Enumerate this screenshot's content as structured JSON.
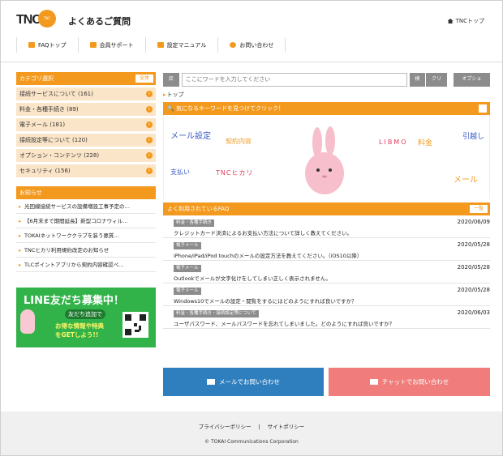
{
  "header": {
    "logo_text": "TNC",
    "logo_badge": "TNC",
    "title": "よくあるご質問",
    "top_link": "TNCトップ"
  },
  "nav": [
    {
      "label": "FAQトップ",
      "icon": "chat-icon"
    },
    {
      "label": "会員サポート",
      "icon": "people-icon"
    },
    {
      "label": "設定マニュアル",
      "icon": "book-icon"
    },
    {
      "label": "お問い合わせ",
      "icon": "phone-icon"
    }
  ],
  "sidebar": {
    "category_title": "カテゴリ選択",
    "all_label": "全体",
    "categories": [
      {
        "label": "接続サービスについて (161)"
      },
      {
        "label": "料金・各種手続き (89)"
      },
      {
        "label": "電子メール (181)"
      },
      {
        "label": "接続設定等について (120)"
      },
      {
        "label": "オプション・コンテンツ (228)"
      },
      {
        "label": "セキュリティ (156)"
      }
    ],
    "news_title": "お知らせ",
    "news": [
      "光回線接続サービスの設備増設工事予定の…",
      "【6月末まで期間延長】新型コロナウィル…",
      "TOKAIネットワーククラブを装う悪質…",
      "TNCヒカリ利用規約改定のお知らせ",
      "TLCポイントアプリから契約内容確認ペ…"
    ]
  },
  "line_banner": {
    "title": "LINE友だち募集中！",
    "sub": "友だち追加で",
    "body_line1": "お得な情報や特典",
    "body_line2": "をGETしよう!!"
  },
  "search": {
    "back_label": "戻る",
    "placeholder": "ここにワードを入力してください",
    "search_label": "検索",
    "clear_label": "クリア",
    "option_label": "オプション"
  },
  "breadcrumb": "トップ",
  "keywords": {
    "title": "気になるキーワードを見つけてクリック！",
    "items": [
      {
        "text": "メール設定",
        "color": "#3b5bc6",
        "size": "10px"
      },
      {
        "text": "契約内容",
        "color": "#f39a1e",
        "size": "8px"
      },
      {
        "text": "LIBMO",
        "color": "#e23b5a",
        "size": "8px"
      },
      {
        "text": "料金",
        "color": "#f39a1e",
        "size": "9px"
      },
      {
        "text": "引越し",
        "color": "#3b5bc6",
        "size": "9px"
      },
      {
        "text": "支払い",
        "color": "#3b5bc6",
        "size": "8px"
      },
      {
        "text": "TNCヒカリ",
        "color": "#e23b5a",
        "size": "8px"
      },
      {
        "text": "メール",
        "color": "#f39a1e",
        "size": "10px"
      }
    ]
  },
  "faq": {
    "title": "よく利用されているFAQ",
    "all_label": "一覧",
    "items": [
      {
        "tag": "料金・各種手続き",
        "date": "2020/06/09",
        "question": "クレジットカード決済によるお支払い方法について詳しく教えてください。"
      },
      {
        "tag": "電子メール",
        "date": "2020/05/28",
        "question": "iPhone/iPad/iPod touchのメールの設定方法を教えてください。（iOS10以降）"
      },
      {
        "tag": "電子メール",
        "date": "2020/05/28",
        "question": "Outlookでメールが文字化けをしてしまい正しく表示されません。"
      },
      {
        "tag": "電子メール",
        "date": "2020/05/28",
        "question": "Windows10でメールの設定・閲覧をするにはどのようにすれば良いですか？"
      },
      {
        "tag": "料金・各種手続き・接続設定等について",
        "date": "2020/06/03",
        "question": "ユーザパスワード、メールパスワードを忘れてしまいました。どのようにすれば良いですか？"
      }
    ]
  },
  "contact": {
    "mail_label": "メールでお問い合わせ",
    "chat_label": "チャットでお問い合わせ"
  },
  "footer": {
    "privacy": "プライバシーポリシー",
    "separator": "|",
    "site_policy": "サイトポリシー",
    "copyright": "© TOKAI Communications Corporation"
  },
  "colors": {
    "accent": "#f39a1e",
    "category_bg": "#fbe5c8",
    "line_green": "#32b34a",
    "mail_blue": "#2f7fbf",
    "chat_pink": "#f07c7c"
  }
}
